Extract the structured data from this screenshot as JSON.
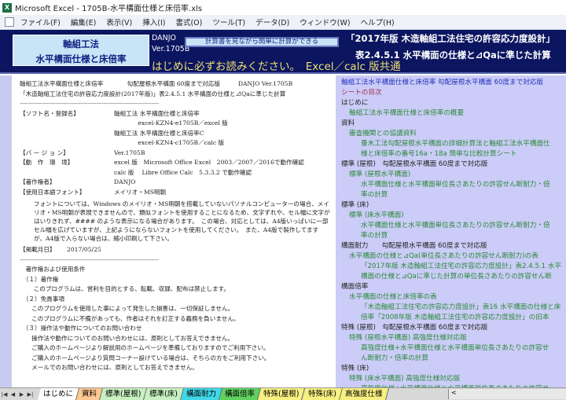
{
  "window": {
    "title": "Microsoft Excel - 1705B-水平構面仕様と床倍率.xls"
  },
  "menu": [
    "ファイル(F)",
    "編集(E)",
    "表示(V)",
    "挿入(I)",
    "書式(O)",
    "ツール(T)",
    "データ(D)",
    "ウィンドウ(W)",
    "ヘルプ(H)"
  ],
  "header": {
    "logo_line1": "軸組工法",
    "logo_line2": "水平構面仕様と床倍率",
    "author": "DANJO",
    "version": "Ver.1705B",
    "calc_button": "計算書を見ながら簡単に計算ができる",
    "readme": "はじめに必ずお読みください。　Excel／calc 版共通",
    "right_line1": "「2017年版 木造軸組工法住宅の許容応力度設計」",
    "right_line2": "表2.4.5.1 水平構面の仕様と⊿Qaに準じた計算"
  },
  "doc": {
    "line1": "軸組工法水平構面仕様と床倍率　　　　勾配屋根水平構面 60度まで対応版　　　DANJO Ver.1705B",
    "line2": "「木造軸組工法住宅の許容応力度設計(2017年版)」表2.4.5.1 水平構面の仕様と⊿Qaに準じた計算",
    "dash": "------------------------------------------------------------------------------",
    "rows": [
      {
        "label": "【ソフト名・登録名】",
        "value": "軸組工法 水平構面仕様と床倍率"
      },
      {
        "label": "",
        "value": "　　　　excel-KZN4-e1705B／excel 版"
      },
      {
        "label": "",
        "value": "軸組工法 水平構面仕様と床倍率C"
      },
      {
        "label": "",
        "value": "　　　　excel-KZN4-c1705B／calc 版"
      },
      {
        "label": "【バ ー ジ ョ ン】",
        "value": "Ver.1705B"
      },
      {
        "label": "【動　作　環　境】",
        "value": "excel 版　Microsoft Office Excel　2003／2007／2016で動作確認"
      },
      {
        "label": "",
        "value": "calc 版　 Libre Office Calc　5.3.3.2 で動作確認"
      },
      {
        "label": "【著作権者】",
        "value": "DANJO"
      },
      {
        "label": "【使用日本語フォント】",
        "value": "メイリオ・MS明朝"
      }
    ],
    "font_note": "フォントについては、Windows のメイリオ・MS明朝を搭載していないパソナルコンピューターの場合、メイリオ・MS明朝が表現できませんので、類似フォントを使用することになるため、文字ずれや、セル幅に文字がはいりきれず、#### のような表示になる場合があります。　この場合、対応としては、A4版いっぱいに一部セル幅を広げていますが、上記ようにならないフォントを使用してください。　また、A4版で製作してますが、A4版で入らない場合は、縮小印刷して下さい。",
    "date_label": "【掲載月日】",
    "date": "2017/05/25",
    "terms": [
      "　著作権および使用条件",
      "　（１）著作権",
      "　　 このプログラムは、営利を目的とする、転載、収録、配布は禁止します。",
      "　（２）免責事項",
      "　　このプログラムを使用した事によって発生した損害は、一切保証しません。",
      "　　このプログラムに不備があっても、作者はそれを訂正する義務を負いません。",
      "　（３）操作法や動作についてのお問い合わせ",
      "　　操作法や動作についてのお問い合わせには、原則としてお答えできません。",
      "　　ご購入のホームページより解説用のホームページを準備しておりますのでご利用下さい。",
      "　　ご購入のホームページより質問コーナー設けている場合は、そちらの方をご利用下さい。",
      "　　メールでのお問い合わせには、原則としてお答えできません。"
    ]
  },
  "toc": {
    "title": "軸組工法水平構面仕様と床倍率 勾配屋根水平構面 60度まで対応版",
    "heading": "シートの目次",
    "items": [
      {
        "level": 0,
        "text": "はじめに"
      },
      {
        "level": 1,
        "text": "軸組工法水平構面仕様と床倍率の概要"
      },
      {
        "level": 0,
        "text": "資料"
      },
      {
        "level": 1,
        "text": "審査機関との協議資料"
      },
      {
        "level": 2,
        "text": "垂木工法勾配屋根水平構面の詳細計算法と軸組工法水平構面仕"
      },
      {
        "level": 2,
        "text": "様と床倍率の番号16a・18a 簡単な比較計算シート"
      },
      {
        "level": 0,
        "text": "標準 (屋根)　勾配屋根水平構面 60度まで対応版"
      },
      {
        "level": 1,
        "text": "標準 (屋根水平構面)"
      },
      {
        "level": 2,
        "text": "水平構面仕様と水平構面単位長さあたりの許容せん断耐力・倍"
      },
      {
        "level": 2,
        "text": "率の計算"
      },
      {
        "level": 0,
        "text": "標準 (床)"
      },
      {
        "level": 1,
        "text": "標準 (床水平構面)"
      },
      {
        "level": 2,
        "text": "水平構面仕様と水平構面単位長さあたりの許容せん断耐力・倍"
      },
      {
        "level": 2,
        "text": "率の計算"
      },
      {
        "level": 0,
        "text": "構面耐力　　勾配屋根水平構面 60度まで対応版"
      },
      {
        "level": 1,
        "text": "水平構面の仕様と⊿Qa(単位長さあたりの許容せん断耐力)の表"
      },
      {
        "level": 2,
        "text": "「2017年版 木造軸組工法住宅の許容応力度設計」表2.4.5.1 水平"
      },
      {
        "level": 2,
        "text": "構面の仕様と⊿Qaに準じた計算の単位長さあたりの許容せん断"
      },
      {
        "level": 0,
        "text": "構面倍率"
      },
      {
        "level": 1,
        "text": "水平構面の仕様と床倍率の表"
      },
      {
        "level": 2,
        "text": "「木造軸組工法住宅の許容応力度設計」表16 水平構面の仕様と床"
      },
      {
        "level": 2,
        "text": "倍率「2008年版 木造軸組工法住宅の許容応力度設計」の旧本"
      },
      {
        "level": 0,
        "text": "特殊 (屋根)　勾配屋根水平構面 60度まで対応版"
      },
      {
        "level": 1,
        "text": "特殊 (屋根水平構面) 高強度仕様対応版"
      },
      {
        "level": 2,
        "text": "高強度仕様+水平構面仕様と水平構面単位長さあたりの許容せ"
      },
      {
        "level": 2,
        "text": "ん断耐力・倍率の計算"
      },
      {
        "level": 0,
        "text": "特殊 (床)"
      },
      {
        "level": 1,
        "text": "特殊 (床水平構面) 高強度仕様対応版"
      },
      {
        "level": 2,
        "text": "高強度仕様+水平構面仕様と水平構面単位長さあたりの許容せ"
      }
    ]
  },
  "tabs": [
    {
      "label": "はじめに",
      "color": "#ffffff"
    },
    {
      "label": "資料",
      "color": "#ffc890"
    },
    {
      "label": "標準(屋根)",
      "color": "#c8f0c0"
    },
    {
      "label": "標準(床)",
      "color": "#c8f0c0"
    },
    {
      "label": "構面耐力",
      "color": "#40d8e8"
    },
    {
      "label": "構面倍率",
      "color": "#60d060"
    },
    {
      "label": "特殊(屋根)",
      "color": "#f8f080"
    },
    {
      "label": "特殊(床)",
      "color": "#f8f080"
    },
    {
      "label": "高強度仕様",
      "color": "#f8f080"
    }
  ]
}
